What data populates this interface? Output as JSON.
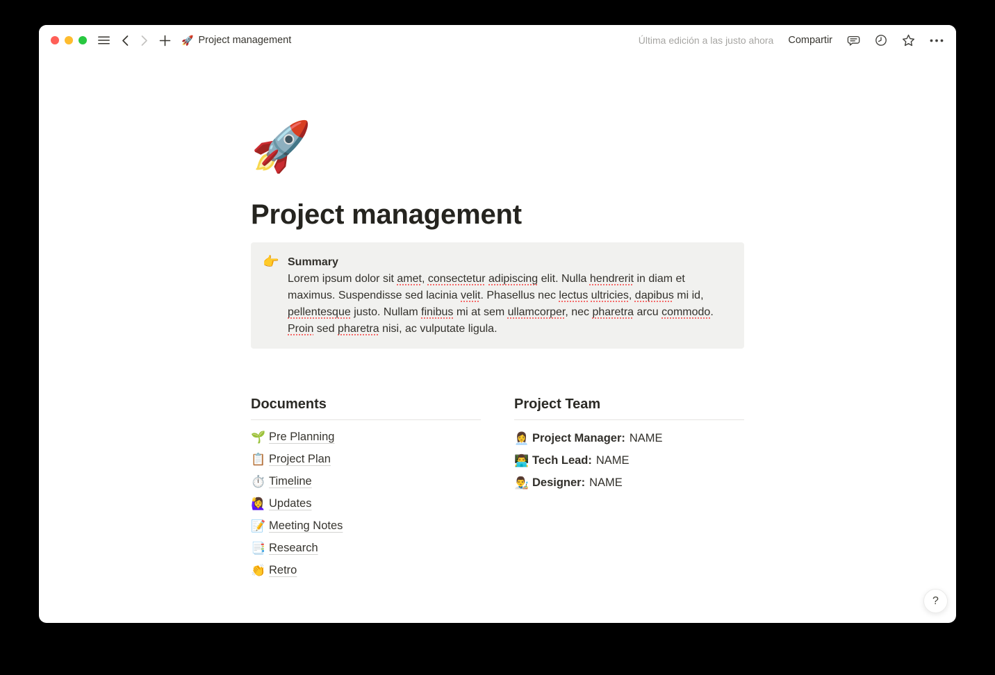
{
  "colors": {
    "light_red": "#FF5F57",
    "light_yellow": "#FEBC2E",
    "light_green": "#28C840",
    "callout_bg": "#F1F1EF",
    "divider": "#E5E4E1",
    "text": "#37352F"
  },
  "titlebar": {
    "breadcrumb_icon": "🚀",
    "breadcrumb_title": "Project management",
    "last_edited": "Última edición a las justo ahora",
    "share_label": "Compartir"
  },
  "page": {
    "icon": "🚀",
    "title": "Project management",
    "callout": {
      "icon": "👉",
      "heading": "Summary",
      "paragraph": [
        {
          "t": "Lorem ipsum dolor sit "
        },
        {
          "t": "amet",
          "m": true
        },
        {
          "t": ", "
        },
        {
          "t": "consectetur",
          "m": true
        },
        {
          "t": " "
        },
        {
          "t": "adipiscing",
          "m": true
        },
        {
          "t": " elit. Nulla "
        },
        {
          "t": "hendrerit",
          "m": true
        },
        {
          "t": " in diam et maximus. Suspendisse sed lacinia "
        },
        {
          "t": "velit",
          "m": true
        },
        {
          "t": ". Phasellus nec "
        },
        {
          "t": "lectus",
          "m": true
        },
        {
          "t": " "
        },
        {
          "t": "ultricies",
          "m": true
        },
        {
          "t": ", "
        },
        {
          "t": "dapibus",
          "m": true
        },
        {
          "t": " mi id, "
        },
        {
          "t": "pellentesque",
          "m": true
        },
        {
          "t": " justo. Nullam "
        },
        {
          "t": "finibus",
          "m": true
        },
        {
          "t": " mi at sem "
        },
        {
          "t": "ullamcorper",
          "m": true
        },
        {
          "t": ", nec "
        },
        {
          "t": "pharetra",
          "m": true
        },
        {
          "t": " arcu "
        },
        {
          "t": "commodo",
          "m": true
        },
        {
          "t": ". "
        },
        {
          "t": "Proin",
          "m": true
        },
        {
          "t": " sed "
        },
        {
          "t": "pharetra",
          "m": true
        },
        {
          "t": " nisi, ac vulputate ligula."
        }
      ]
    },
    "documents": {
      "heading": "Documents",
      "items": [
        {
          "icon": "🌱",
          "label": "Pre Planning"
        },
        {
          "icon": "📋",
          "label": "Project Plan"
        },
        {
          "icon": "⏱️",
          "label": "Timeline"
        },
        {
          "icon": "🙋‍♀️",
          "label": "Updates"
        },
        {
          "icon": "📝",
          "label": "Meeting Notes"
        },
        {
          "icon": "📑",
          "label": "Research"
        },
        {
          "icon": "👏",
          "label": "Retro"
        }
      ]
    },
    "team": {
      "heading": "Project Team",
      "members": [
        {
          "icon": "👩‍💼",
          "role": "Project Manager:",
          "name": "NAME"
        },
        {
          "icon": "👨‍💻",
          "role": "Tech Lead:",
          "name": "NAME"
        },
        {
          "icon": "👨‍🎨",
          "role": "Designer:",
          "name": "NAME"
        }
      ]
    },
    "help_label": "?"
  }
}
